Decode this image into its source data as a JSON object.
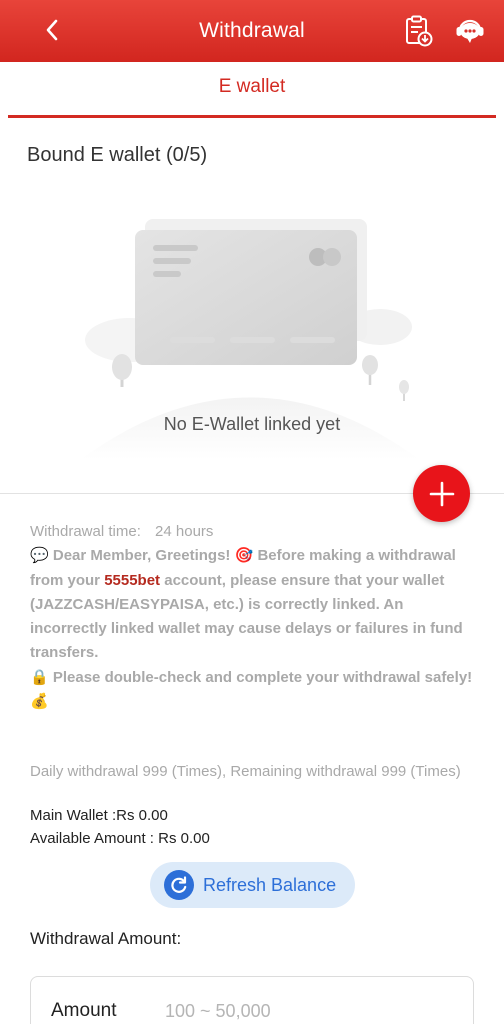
{
  "header": {
    "title": "Withdrawal",
    "back_icon": "chevron-left-icon",
    "record_icon": "clipboard-download-icon",
    "support_icon": "customer-service-chat-icon",
    "color": "#d9302a"
  },
  "tabs": [
    {
      "label": "E wallet",
      "active": true
    }
  ],
  "ewallet": {
    "title": "Bound E wallet (0/5)",
    "empty_text": "No E-Wallet linked yet",
    "add_icon": "plus-icon"
  },
  "notice": {
    "time_label": "Withdrawal time:",
    "time_value": "24 hours",
    "greeting_emoji": "💬",
    "greeting": "Dear Member, Greetings!",
    "target_emoji": "🎯",
    "msg_before_brand": "Before making a withdrawal from your",
    "brand": "5555bet",
    "msg_after_brand": "account, please ensure that your wallet (JAZZCASH/EASYPAISA, etc.) is correctly linked. An incorrectly linked wallet may cause delays or failures in fund transfers.",
    "lock_emoji": "🔒",
    "safety_text": "Please double-check and complete your withdrawal safely!",
    "money_emoji": "💰"
  },
  "limits": {
    "daily_text": "Daily withdrawal 999 (Times), Remaining withdrawal 999 (Times)",
    "main_wallet": "Main Wallet :Rs 0.00",
    "available_amount": "Available Amount : Rs 0.00"
  },
  "refresh": {
    "label": "Refresh Balance",
    "icon": "refresh-icon"
  },
  "amount": {
    "section_label": "Withdrawal Amount:",
    "field_label": "Amount",
    "placeholder": "100 ~ 50,000",
    "value": ""
  },
  "colors": {
    "accent": "#d32a22",
    "add_button": "#e8141a",
    "refresh_bg": "#dceaf9",
    "refresh_fg": "#2d6fd8",
    "brand_text": "#b52a1f"
  }
}
